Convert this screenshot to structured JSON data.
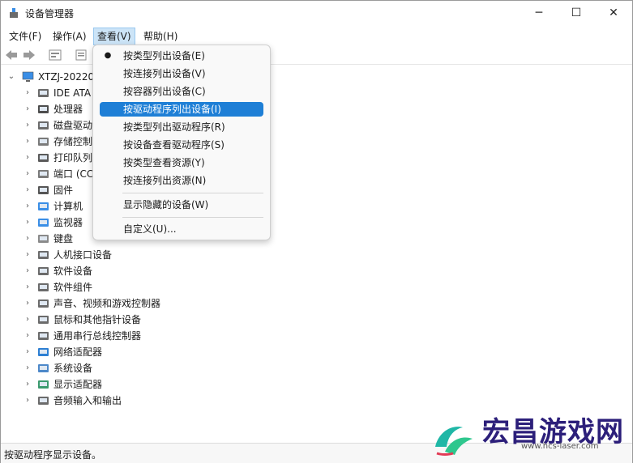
{
  "window": {
    "title": "设备管理器",
    "minimize": "─",
    "maximize": "☐",
    "close": "✕"
  },
  "menubar": [
    {
      "label": "文件(F)"
    },
    {
      "label": "操作(A)"
    },
    {
      "label": "查看(V)"
    },
    {
      "label": "帮助(H)"
    }
  ],
  "tree": {
    "root": "XTZJ-20220",
    "items": [
      {
        "label": "IDE ATA",
        "icon": "ide-icon"
      },
      {
        "label": "处理器",
        "icon": "processor-icon"
      },
      {
        "label": "磁盘驱动",
        "icon": "disk-icon"
      },
      {
        "label": "存储控制",
        "icon": "storage-icon"
      },
      {
        "label": "打印队列",
        "icon": "printer-icon"
      },
      {
        "label": "端口 (CC",
        "icon": "port-icon"
      },
      {
        "label": "固件",
        "icon": "firmware-icon"
      },
      {
        "label": "计算机",
        "icon": "computer-icon"
      },
      {
        "label": "监视器",
        "icon": "monitor-icon"
      },
      {
        "label": "键盘",
        "icon": "keyboard-icon"
      },
      {
        "label": "人机接口设备",
        "icon": "hid-icon"
      },
      {
        "label": "软件设备",
        "icon": "software-device-icon"
      },
      {
        "label": "软件组件",
        "icon": "software-component-icon"
      },
      {
        "label": "声音、视频和游戏控制器",
        "icon": "speaker-icon"
      },
      {
        "label": "鼠标和其他指针设备",
        "icon": "mouse-icon"
      },
      {
        "label": "通用串行总线控制器",
        "icon": "usb-icon"
      },
      {
        "label": "网络适配器",
        "icon": "network-icon"
      },
      {
        "label": "系统设备",
        "icon": "system-icon"
      },
      {
        "label": "显示适配器",
        "icon": "display-adapter-icon"
      },
      {
        "label": "音频输入和输出",
        "icon": "audio-io-icon"
      }
    ]
  },
  "view_menu": {
    "items": [
      {
        "label": "按类型列出设备(E)",
        "checked": true
      },
      {
        "label": "按连接列出设备(V)"
      },
      {
        "label": "按容器列出设备(C)"
      },
      {
        "label": "按驱动程序列出设备(I)",
        "selected": true
      },
      {
        "label": "按类型列出驱动程序(R)"
      },
      {
        "label": "按设备查看驱动程序(S)"
      },
      {
        "label": "按类型查看资源(Y)"
      },
      {
        "label": "按连接列出资源(N)"
      },
      {
        "label": "显示隐藏的设备(W)"
      },
      {
        "label": "自定义(U)..."
      }
    ],
    "bullet": "●"
  },
  "statusbar": {
    "text": "按驱动程序显示设备。"
  },
  "watermark": {
    "title": "宏昌游戏网",
    "url": "www.hcs-laser.com"
  },
  "colors": {
    "accent": "#1e7fd6",
    "menu_active": "#cce4f7"
  }
}
